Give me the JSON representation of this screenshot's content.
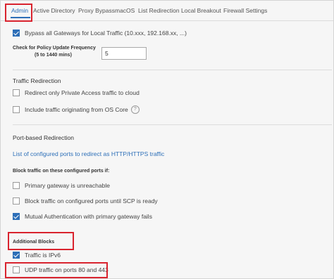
{
  "tabs": [
    {
      "label": "Admin"
    },
    {
      "label": "Active Directory"
    },
    {
      "label": "Proxy Bypass"
    },
    {
      "label": "macOS"
    },
    {
      "label": "List Redirection"
    },
    {
      "label": "Local Breakout"
    },
    {
      "label": "Firewall Settings"
    }
  ],
  "admin": {
    "bypass_label": "Bypass all Gateways for Local Traffic (10.xxx, 192.168.xx, ...)",
    "policy_freq_line1": "Check for Policy Update Frequency",
    "policy_freq_line2": "(5 to 1440 mins)",
    "policy_freq_value": "5"
  },
  "traffic_redirection": {
    "title": "Traffic Redirection",
    "private_access_label": "Redirect only Private Access traffic to cloud",
    "os_core_label": "Include traffic originating from OS Core",
    "help_icon": "?"
  },
  "port_redirection": {
    "title": "Port-based Redirection",
    "ports_link": "List of configured ports to redirect as HTTP/HTTPS traffic",
    "block_heading": "Block traffic on these configured ports if:",
    "primary_unreachable": "Primary gateway is unreachable",
    "scp_ready": "Block traffic on configured ports until SCP is ready",
    "mutual_auth": "Mutual Authentication with primary gateway fails"
  },
  "additional_blocks": {
    "title": "Additional Blocks",
    "ipv6": "Traffic is IPv6",
    "udp": "UDP traffic on ports 80 and 443"
  },
  "colors": {
    "accent": "#2d6fb8",
    "highlight": "#d9232e"
  }
}
